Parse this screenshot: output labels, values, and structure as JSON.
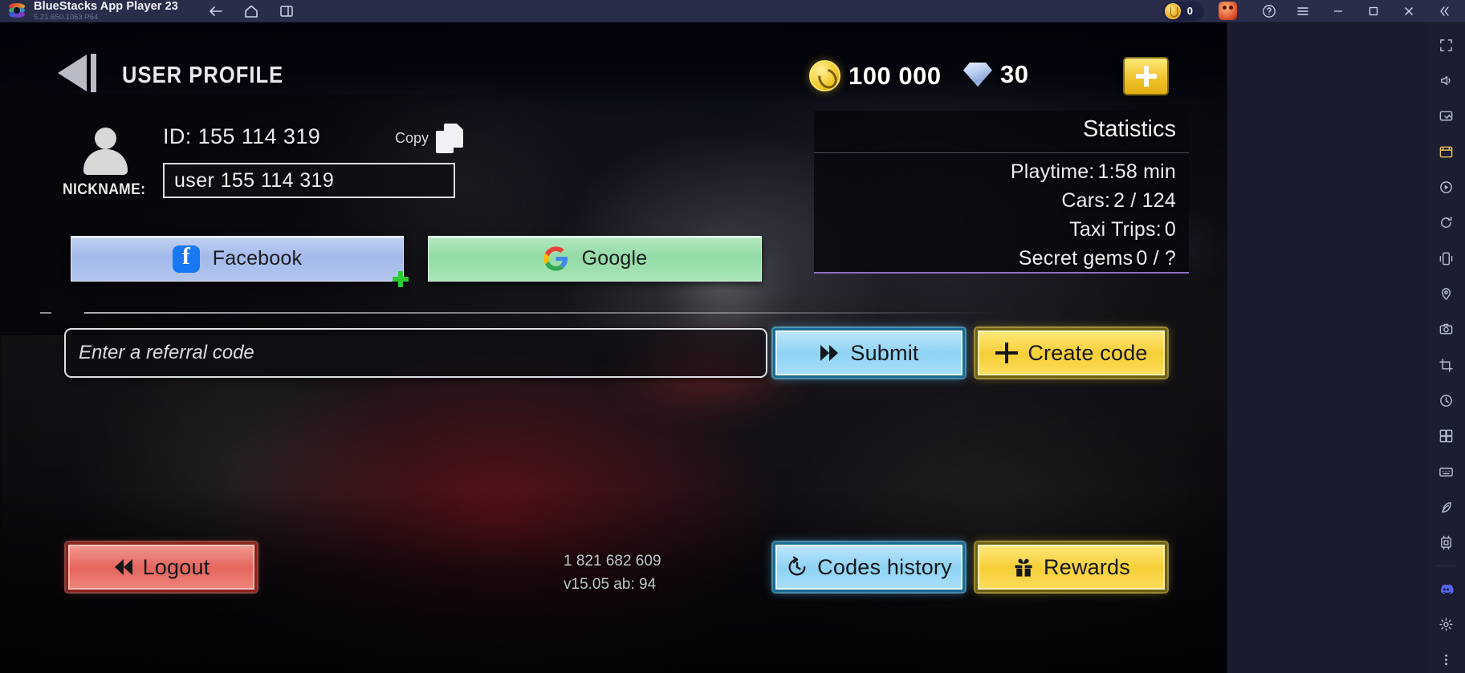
{
  "titlebar": {
    "app_name": "BlueStacks App Player 23",
    "version": "5.21.650.1063  P64",
    "nav": [
      {
        "name": "back-icon",
        "label": "Back"
      },
      {
        "name": "home-icon",
        "label": "Home"
      },
      {
        "name": "multi-instance-icon",
        "label": "Multi-instance"
      }
    ],
    "points_value": "0",
    "window_controls": [
      "help-icon",
      "menu-icon",
      "minimize-icon",
      "maximize-icon",
      "close-icon",
      "collapse-icon"
    ]
  },
  "game": {
    "header": {
      "page_title": "USER PROFILE",
      "back_label": "Back",
      "coins": "100 000",
      "gems": "30",
      "add_label": "+"
    },
    "profile": {
      "id_label": "ID: 155 114 319",
      "copy_label": "Copy",
      "nickname_label": "NICKNAME:",
      "nickname_value": "user 155 114 319"
    },
    "statistics": {
      "title": "Statistics",
      "rows": [
        {
          "label": "Playtime:",
          "value": "1:58 min"
        },
        {
          "label": "Cars:",
          "value": "2 / 124"
        },
        {
          "label": "Taxi Trips:",
          "value": "0"
        },
        {
          "label": "Secret gems",
          "value": "0 / ?"
        }
      ]
    },
    "social": {
      "facebook_label": "Facebook",
      "google_label": "Google"
    },
    "referral": {
      "placeholder": "Enter a referral code",
      "value": "",
      "submit_label": "Submit",
      "create_label": "Create code"
    },
    "footer": {
      "logout_label": "Logout",
      "history_label": "Codes history",
      "rewards_label": "Rewards",
      "build_number": "1 821 682 609",
      "version_text": "v15.05 ab: 94"
    }
  },
  "sidebar": {
    "items": [
      "fullscreen-icon",
      "volume-icon",
      "screenshot-icon",
      "media-manager-icon",
      "video-record-icon",
      "rotate-icon",
      "shake-icon",
      "location-icon",
      "camera-icon",
      "crop-icon",
      "macro-icon",
      "multi-instance-sync-icon",
      "keymapping-icon",
      "eco-mode-icon",
      "trim-memory-icon",
      "discord-icon",
      "settings-icon",
      "more-icon"
    ]
  },
  "colors": {
    "accent_yellow": "#f6cf37",
    "accent_blue": "#8ed3f4",
    "accent_red": "#e4655c",
    "discord": "#5865f2"
  }
}
